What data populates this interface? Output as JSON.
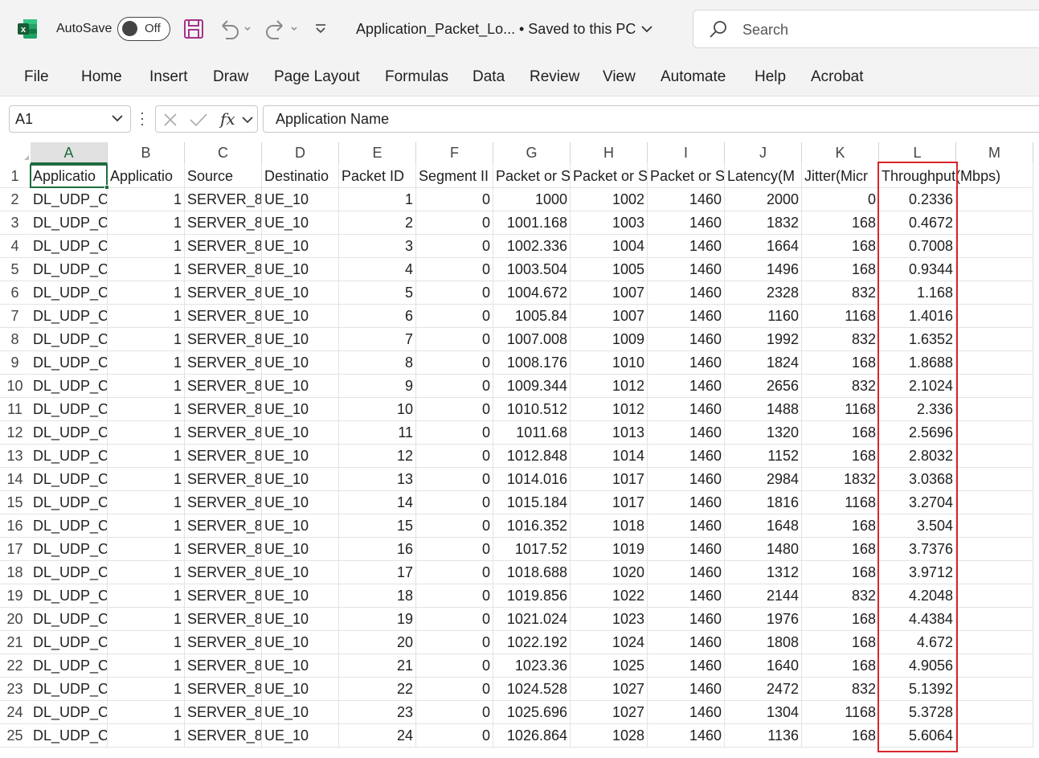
{
  "titlebar": {
    "autosave_label": "AutoSave",
    "autosave_state": "Off",
    "document_title": "Application_Packet_Lo...",
    "saved_status": "• Saved to this PC",
    "search_placeholder": "Search",
    "icons": [
      "excel-logo-icon",
      "save-icon",
      "undo-icon",
      "redo-icon",
      "customize-toolbar-icon",
      "search-icon"
    ]
  },
  "ribbon": {
    "tabs": [
      "File",
      "Home",
      "Insert",
      "Draw",
      "Page Layout",
      "Formulas",
      "Data",
      "Review",
      "View",
      "Automate",
      "Help",
      "Acrobat"
    ]
  },
  "formula_bar": {
    "name_box": "A1",
    "formula": "Application Name"
  },
  "sheet": {
    "selected_cell": "A1",
    "highlighted_column": "L",
    "columns": [
      "A",
      "B",
      "C",
      "D",
      "E",
      "F",
      "G",
      "H",
      "I",
      "J",
      "K",
      "L",
      "M"
    ],
    "row_numbers": [
      "1",
      "2",
      "3",
      "4",
      "5",
      "6",
      "7",
      "8",
      "9",
      "10",
      "11",
      "12",
      "13",
      "14",
      "15",
      "16",
      "17",
      "18",
      "19",
      "20",
      "21",
      "22",
      "23",
      "24",
      "25"
    ],
    "header_row": [
      "Applicatio",
      "Applicatio",
      "Source",
      "Destinatio",
      "Packet ID",
      "Segment II",
      "Packet or S",
      "Packet or S",
      "Packet or S",
      "Latency(M",
      "Jitter(Micr",
      "Throughput(Mbps)",
      ""
    ],
    "rows": [
      [
        "DL_UDP_C",
        "1",
        "SERVER_8",
        "UE_10",
        "1",
        "0",
        "1000",
        "1002",
        "1460",
        "2000",
        "0",
        "0.2336",
        ""
      ],
      [
        "DL_UDP_C",
        "1",
        "SERVER_8",
        "UE_10",
        "2",
        "0",
        "1001.168",
        "1003",
        "1460",
        "1832",
        "168",
        "0.4672",
        ""
      ],
      [
        "DL_UDP_C",
        "1",
        "SERVER_8",
        "UE_10",
        "3",
        "0",
        "1002.336",
        "1004",
        "1460",
        "1664",
        "168",
        "0.7008",
        ""
      ],
      [
        "DL_UDP_C",
        "1",
        "SERVER_8",
        "UE_10",
        "4",
        "0",
        "1003.504",
        "1005",
        "1460",
        "1496",
        "168",
        "0.9344",
        ""
      ],
      [
        "DL_UDP_C",
        "1",
        "SERVER_8",
        "UE_10",
        "5",
        "0",
        "1004.672",
        "1007",
        "1460",
        "2328",
        "832",
        "1.168",
        ""
      ],
      [
        "DL_UDP_C",
        "1",
        "SERVER_8",
        "UE_10",
        "6",
        "0",
        "1005.84",
        "1007",
        "1460",
        "1160",
        "1168",
        "1.4016",
        ""
      ],
      [
        "DL_UDP_C",
        "1",
        "SERVER_8",
        "UE_10",
        "7",
        "0",
        "1007.008",
        "1009",
        "1460",
        "1992",
        "832",
        "1.6352",
        ""
      ],
      [
        "DL_UDP_C",
        "1",
        "SERVER_8",
        "UE_10",
        "8",
        "0",
        "1008.176",
        "1010",
        "1460",
        "1824",
        "168",
        "1.8688",
        ""
      ],
      [
        "DL_UDP_C",
        "1",
        "SERVER_8",
        "UE_10",
        "9",
        "0",
        "1009.344",
        "1012",
        "1460",
        "2656",
        "832",
        "2.1024",
        ""
      ],
      [
        "DL_UDP_C",
        "1",
        "SERVER_8",
        "UE_10",
        "10",
        "0",
        "1010.512",
        "1012",
        "1460",
        "1488",
        "1168",
        "2.336",
        ""
      ],
      [
        "DL_UDP_C",
        "1",
        "SERVER_8",
        "UE_10",
        "11",
        "0",
        "1011.68",
        "1013",
        "1460",
        "1320",
        "168",
        "2.5696",
        ""
      ],
      [
        "DL_UDP_C",
        "1",
        "SERVER_8",
        "UE_10",
        "12",
        "0",
        "1012.848",
        "1014",
        "1460",
        "1152",
        "168",
        "2.8032",
        ""
      ],
      [
        "DL_UDP_C",
        "1",
        "SERVER_8",
        "UE_10",
        "13",
        "0",
        "1014.016",
        "1017",
        "1460",
        "2984",
        "1832",
        "3.0368",
        ""
      ],
      [
        "DL_UDP_C",
        "1",
        "SERVER_8",
        "UE_10",
        "14",
        "0",
        "1015.184",
        "1017",
        "1460",
        "1816",
        "1168",
        "3.2704",
        ""
      ],
      [
        "DL_UDP_C",
        "1",
        "SERVER_8",
        "UE_10",
        "15",
        "0",
        "1016.352",
        "1018",
        "1460",
        "1648",
        "168",
        "3.504",
        ""
      ],
      [
        "DL_UDP_C",
        "1",
        "SERVER_8",
        "UE_10",
        "16",
        "0",
        "1017.52",
        "1019",
        "1460",
        "1480",
        "168",
        "3.7376",
        ""
      ],
      [
        "DL_UDP_C",
        "1",
        "SERVER_8",
        "UE_10",
        "17",
        "0",
        "1018.688",
        "1020",
        "1460",
        "1312",
        "168",
        "3.9712",
        ""
      ],
      [
        "DL_UDP_C",
        "1",
        "SERVER_8",
        "UE_10",
        "18",
        "0",
        "1019.856",
        "1022",
        "1460",
        "2144",
        "832",
        "4.2048",
        ""
      ],
      [
        "DL_UDP_C",
        "1",
        "SERVER_8",
        "UE_10",
        "19",
        "0",
        "1021.024",
        "1023",
        "1460",
        "1976",
        "168",
        "4.4384",
        ""
      ],
      [
        "DL_UDP_C",
        "1",
        "SERVER_8",
        "UE_10",
        "20",
        "0",
        "1022.192",
        "1024",
        "1460",
        "1808",
        "168",
        "4.672",
        ""
      ],
      [
        "DL_UDP_C",
        "1",
        "SERVER_8",
        "UE_10",
        "21",
        "0",
        "1023.36",
        "1025",
        "1460",
        "1640",
        "168",
        "4.9056",
        ""
      ],
      [
        "DL_UDP_C",
        "1",
        "SERVER_8",
        "UE_10",
        "22",
        "0",
        "1024.528",
        "1027",
        "1460",
        "2472",
        "832",
        "5.1392",
        ""
      ],
      [
        "DL_UDP_C",
        "1",
        "SERVER_8",
        "UE_10",
        "23",
        "0",
        "1025.696",
        "1027",
        "1460",
        "1304",
        "1168",
        "5.3728",
        ""
      ],
      [
        "DL_UDP_C",
        "1",
        "SERVER_8",
        "UE_10",
        "24",
        "0",
        "1026.864",
        "1028",
        "1460",
        "1136",
        "168",
        "5.6064",
        ""
      ]
    ]
  },
  "colors": {
    "excel_green": "#1e6b3f",
    "save_icon": "#a4338c",
    "highlight_red": "#d9262c",
    "chrome_bg": "#f3f3f3"
  }
}
